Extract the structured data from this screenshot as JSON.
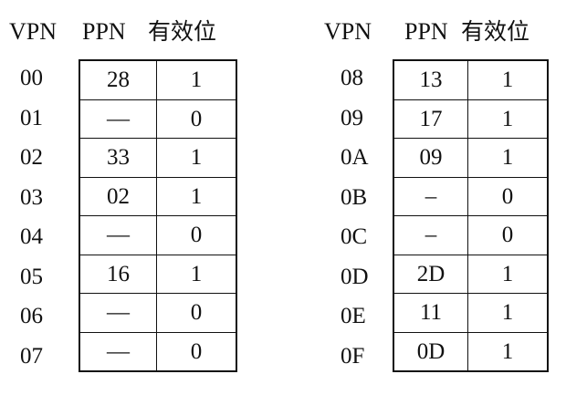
{
  "headers": {
    "vpn": "VPN",
    "ppn": "PPN",
    "valid": "有效位"
  },
  "left_table": {
    "rows": [
      {
        "vpn": "00",
        "ppn": "28",
        "valid": "1"
      },
      {
        "vpn": "01",
        "ppn": "—",
        "valid": "0"
      },
      {
        "vpn": "02",
        "ppn": "33",
        "valid": "1"
      },
      {
        "vpn": "03",
        "ppn": "02",
        "valid": "1"
      },
      {
        "vpn": "04",
        "ppn": "—",
        "valid": "0"
      },
      {
        "vpn": "05",
        "ppn": "16",
        "valid": "1"
      },
      {
        "vpn": "06",
        "ppn": "—",
        "valid": "0"
      },
      {
        "vpn": "07",
        "ppn": "—",
        "valid": "0"
      }
    ]
  },
  "right_table": {
    "rows": [
      {
        "vpn": "08",
        "ppn": "13",
        "valid": "1"
      },
      {
        "vpn": "09",
        "ppn": "17",
        "valid": "1"
      },
      {
        "vpn": "0A",
        "ppn": "09",
        "valid": "1"
      },
      {
        "vpn": "0B",
        "ppn": "–",
        "valid": "0"
      },
      {
        "vpn": "0C",
        "ppn": "–",
        "valid": "0"
      },
      {
        "vpn": "0D",
        "ppn": "2D",
        "valid": "1"
      },
      {
        "vpn": "0E",
        "ppn": "11",
        "valid": "1"
      },
      {
        "vpn": "0F",
        "ppn": "0D",
        "valid": "1"
      }
    ]
  }
}
